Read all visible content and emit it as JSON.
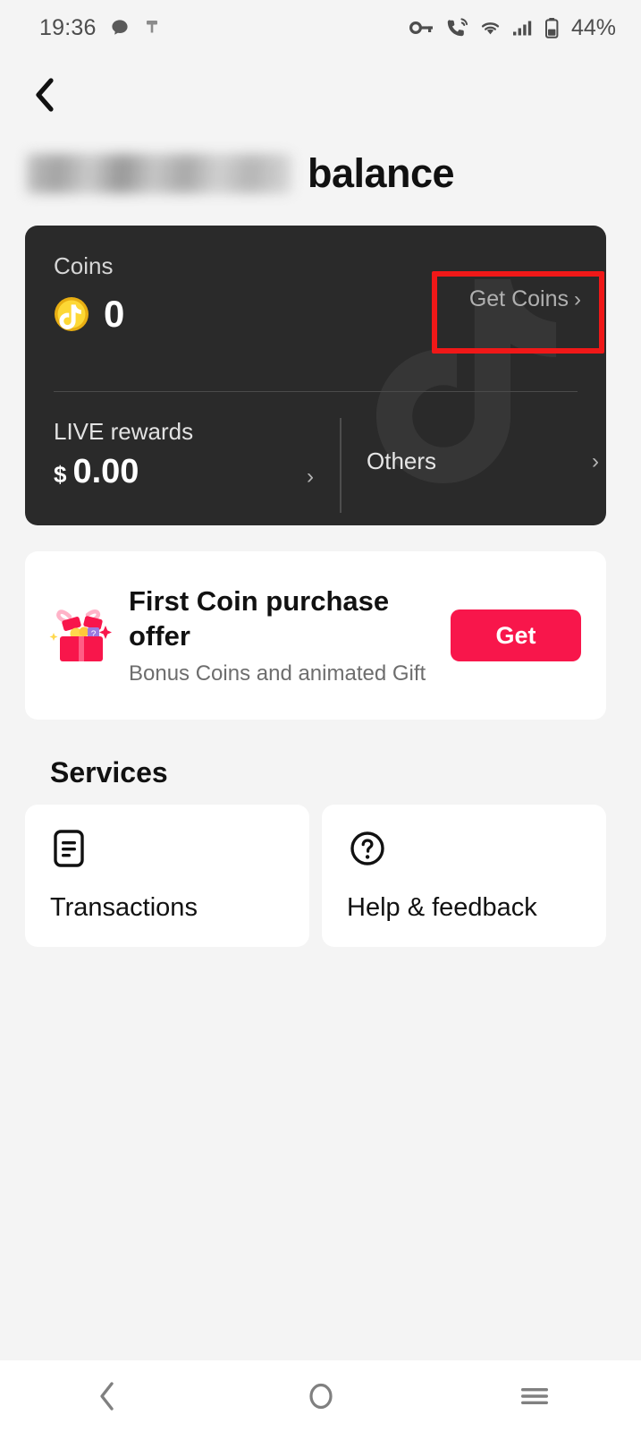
{
  "status_bar": {
    "time": "19:36",
    "battery_percent": "44%",
    "left_icons": [
      "message-bubble-icon",
      "pin-icon"
    ],
    "right_icons": [
      "key-icon",
      "call-sound-icon",
      "wifi-icon",
      "signal-bars-icon",
      "battery-icon"
    ]
  },
  "header": {
    "back_icon": "back-chevron-icon",
    "username_redacted": "",
    "title_suffix": "balance"
  },
  "balance_card": {
    "coins_label": "Coins",
    "coins_amount": "0",
    "coin_icon": "tiktok-coin-icon",
    "get_coins_label": "Get Coins",
    "get_coins_chevron": "›",
    "live_rewards_label": "LIVE rewards",
    "live_rewards_currency": "$",
    "live_rewards_amount": "0.00",
    "live_rewards_chevron": "›",
    "others_label": "Others",
    "others_chevron": "›",
    "background_color": "#2a2a2a",
    "highlight_color": "#f01818"
  },
  "offer_card": {
    "icon": "gift-box-icon",
    "title": "First Coin purchase offer",
    "subtitle": "Bonus Coins and animated Gift",
    "button_label": "Get",
    "button_color": "#f8164b"
  },
  "services": {
    "heading": "Services",
    "items": [
      {
        "label": "Transactions",
        "icon": "document-lines-icon"
      },
      {
        "label": "Help & feedback",
        "icon": "question-circle-icon"
      }
    ]
  },
  "system_nav": {
    "back": "back-icon",
    "home": "home-circle-icon",
    "recents": "recents-menu-icon"
  }
}
